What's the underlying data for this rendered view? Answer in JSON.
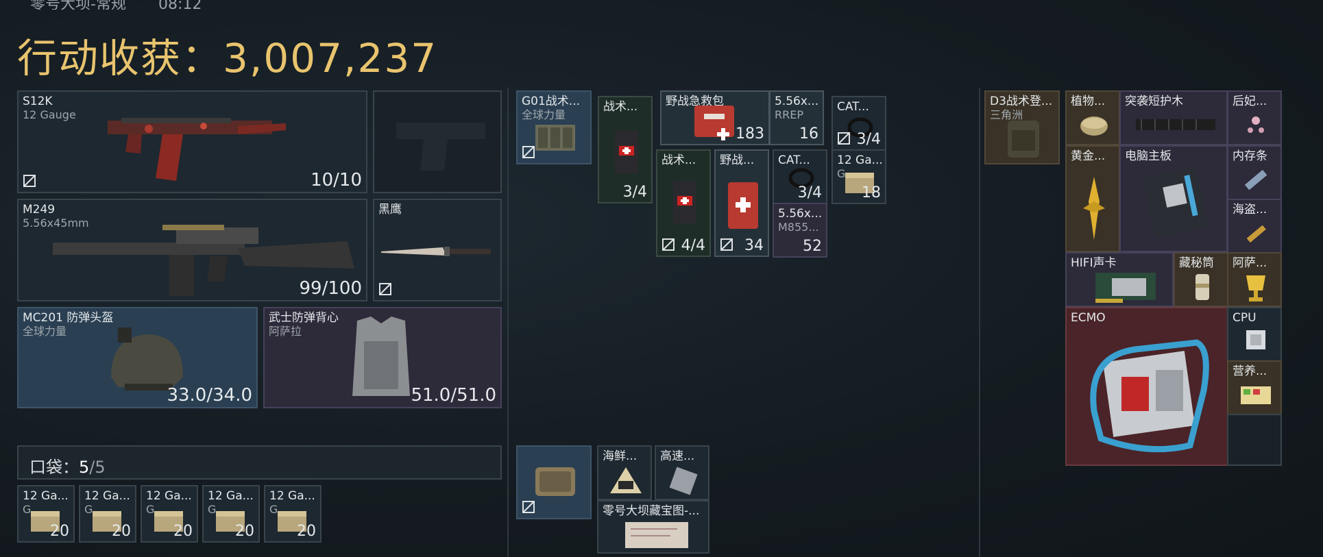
{
  "header": {
    "map_name": "零号大坝-常规",
    "time": "08:12",
    "earnings_label": "行动收获：",
    "earnings_value": "3,007,237"
  },
  "weapons": {
    "primary1": {
      "name": "S12K",
      "sub": "12 Gauge",
      "count": "10/10"
    },
    "primary2": {
      "name": "M249",
      "sub": "5.56x45mm",
      "count": "99/100"
    },
    "melee": {
      "name": "黑鹰"
    },
    "helmet": {
      "name": "MC201 防弹头盔",
      "sub": "全球力量",
      "count": "33.0/34.0"
    },
    "armor": {
      "name": "武士防弹背心",
      "sub": "阿萨拉",
      "count": "51.0/51.0"
    }
  },
  "pocket": {
    "label": "口袋：",
    "count": "5",
    "total": "/5",
    "items": [
      {
        "name": "12 Ga...",
        "sub": "G...",
        "count": "20"
      },
      {
        "name": "12 Ga...",
        "sub": "G...",
        "count": "20"
      },
      {
        "name": "12 Ga...",
        "sub": "G...",
        "count": "20"
      },
      {
        "name": "12 Ga...",
        "sub": "G...",
        "count": "20"
      },
      {
        "name": "12 Ga...",
        "sub": "G...",
        "count": "20"
      }
    ]
  },
  "rig": {
    "main": {
      "name": "G01战术...",
      "sub": "全球力量"
    },
    "items": [
      {
        "name": "战术...",
        "count": "3/4"
      },
      {
        "name": "野战急救包",
        "count": "183"
      },
      {
        "name": "5.56x...",
        "sub": "RREP",
        "count": "16"
      },
      {
        "name": "CAT...",
        "count": "3/4"
      },
      {
        "name": "战术...",
        "count": "4/4"
      },
      {
        "name": "野战...",
        "count": "34"
      },
      {
        "name": "CAT...",
        "count": "3/4"
      },
      {
        "name": "12 Ga...",
        "sub": "G...",
        "count": "18"
      },
      {
        "name": "5.56x...",
        "sub": "M855...",
        "count": "52"
      }
    ]
  },
  "case": {
    "items": [
      {
        "name": "海鲜..."
      },
      {
        "name": "高速..."
      },
      {
        "name": "零号大坝藏宝图-..."
      }
    ]
  },
  "backpack": {
    "main": {
      "name": "D3战术登...",
      "sub": "三角洲"
    },
    "items": [
      {
        "name": "植物..."
      },
      {
        "name": "突袭短护木"
      },
      {
        "name": "后妃..."
      },
      {
        "name": "黄金..."
      },
      {
        "name": "电脑主板"
      },
      {
        "name": "内存条"
      },
      {
        "name": "海盗..."
      },
      {
        "name": "HIFI声卡"
      },
      {
        "name": "藏秘筒"
      },
      {
        "name": "阿萨..."
      },
      {
        "name": "ECMO"
      },
      {
        "name": "CPU"
      },
      {
        "name": "营养..."
      }
    ]
  },
  "colors": {
    "earnings": "#e9c46e",
    "rarity_blue": "#2a3f52",
    "rarity_purple": "#2d2a3a",
    "rarity_gold": "#3a3226",
    "rarity_red": "#4a2428"
  }
}
